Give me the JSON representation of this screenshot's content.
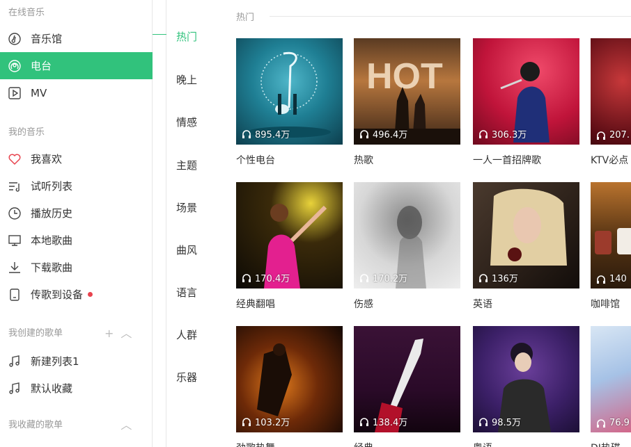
{
  "sidebar": {
    "online_title": "在线音乐",
    "online_items": [
      {
        "label": "音乐馆",
        "icon": "music-hall-icon"
      },
      {
        "label": "电台",
        "icon": "radio-icon",
        "active": true
      },
      {
        "label": "MV",
        "icon": "mv-icon"
      }
    ],
    "my_title": "我的音乐",
    "my_items": [
      {
        "label": "我喜欢",
        "icon": "heart-icon"
      },
      {
        "label": "试听列表",
        "icon": "playlist-icon"
      },
      {
        "label": "播放历史",
        "icon": "clock-icon"
      },
      {
        "label": "本地歌曲",
        "icon": "monitor-icon"
      },
      {
        "label": "下载歌曲",
        "icon": "download-icon"
      },
      {
        "label": "传歌到设备",
        "icon": "device-icon"
      }
    ],
    "created_title": "我创建的歌单",
    "created_items": [
      {
        "label": "新建列表1",
        "icon": "music-note-icon"
      },
      {
        "label": "默认收藏",
        "icon": "music-note-icon"
      }
    ],
    "collected_title": "我收藏的歌单"
  },
  "categories": [
    "热门",
    "晚上",
    "情感",
    "主题",
    "场景",
    "曲风",
    "语言",
    "人群",
    "乐器"
  ],
  "main": {
    "section_title": "热门",
    "cards": [
      {
        "count": "895.4万",
        "title": "个性电台"
      },
      {
        "count": "496.4万",
        "title": "热歌"
      },
      {
        "count": "306.3万",
        "title": "一人一首招牌歌"
      },
      {
        "count": "207.",
        "title": "KTV必点"
      },
      {
        "count": "170.4万",
        "title": "经典翻唱"
      },
      {
        "count": "170.2万",
        "title": "伤感"
      },
      {
        "count": "136万",
        "title": "英语"
      },
      {
        "count": "140",
        "title": "咖啡馆"
      },
      {
        "count": "103.2万",
        "title": "劲歌热舞"
      },
      {
        "count": "138.4万",
        "title": "经典"
      },
      {
        "count": "98.5万",
        "title": "粤语"
      },
      {
        "count": "76.9",
        "title": "DJ热碟"
      }
    ]
  },
  "colors": {
    "accent": "#31c27c",
    "dot": "#e8434e"
  }
}
